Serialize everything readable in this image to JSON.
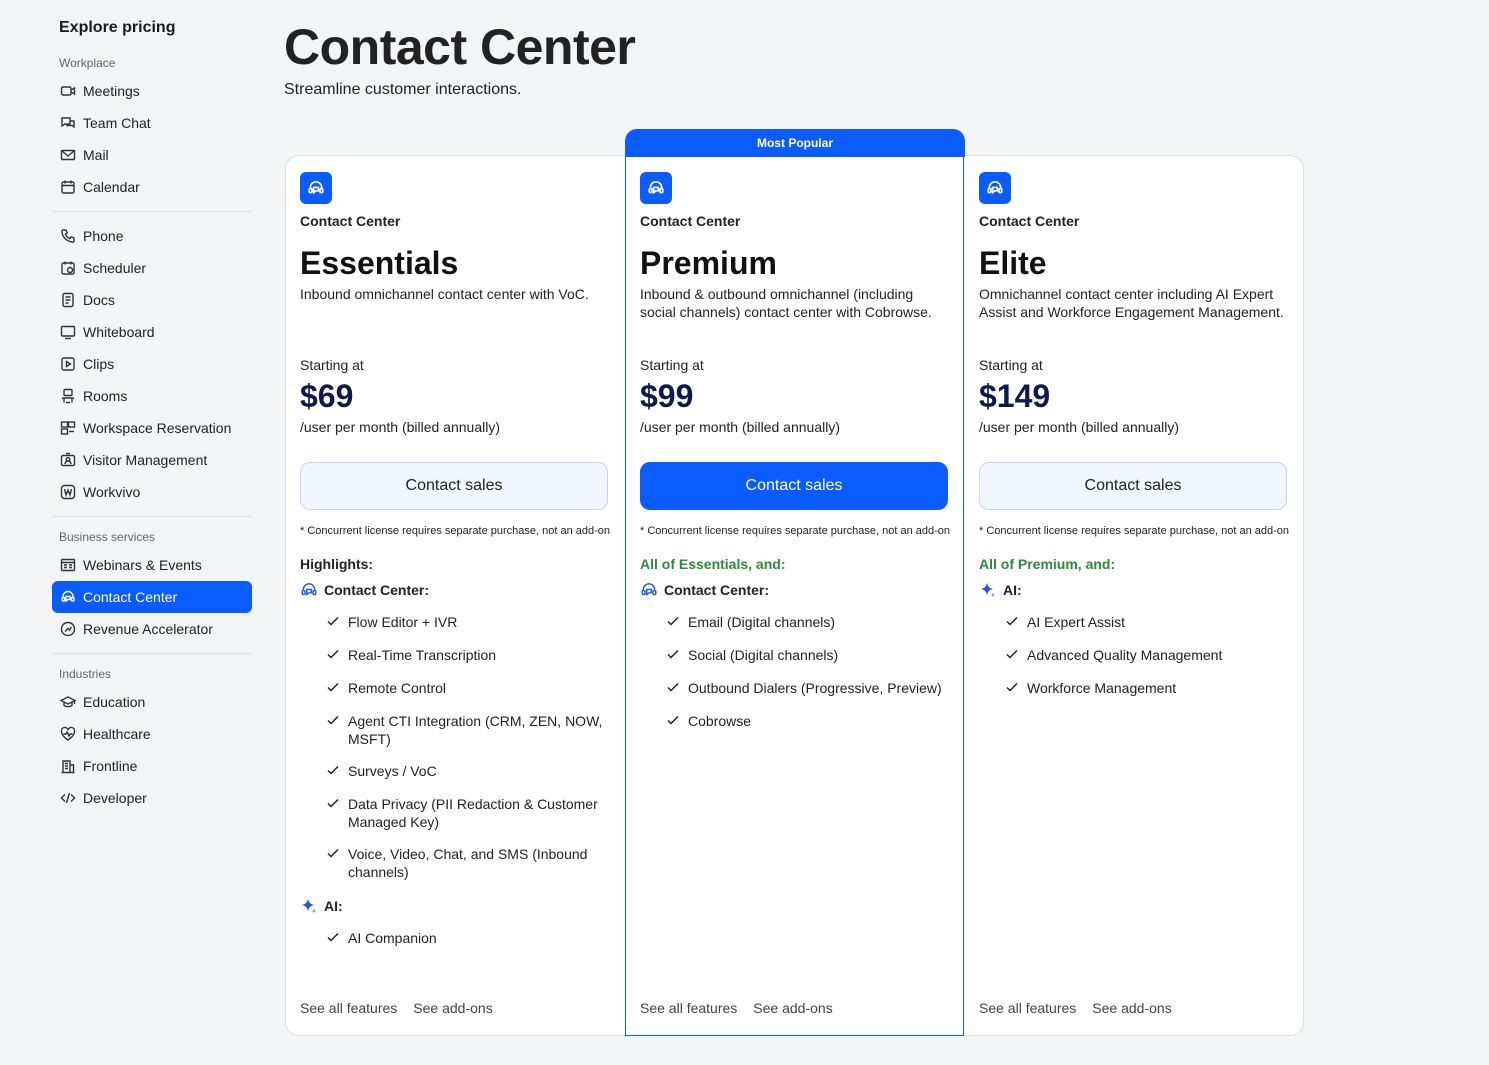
{
  "sidebar": {
    "title": "Explore pricing",
    "sections": {
      "workplace": "Workplace",
      "business": "Business services",
      "industries": "Industries"
    },
    "workplace_items": [
      {
        "label": "Meetings",
        "icon": "video-icon"
      },
      {
        "label": "Team Chat",
        "icon": "chat-icon"
      },
      {
        "label": "Mail",
        "icon": "mail-icon"
      },
      {
        "label": "Calendar",
        "icon": "calendar-icon"
      }
    ],
    "more_items": [
      {
        "label": "Phone",
        "icon": "phone-icon"
      },
      {
        "label": "Scheduler",
        "icon": "scheduler-icon"
      },
      {
        "label": "Docs",
        "icon": "docs-icon"
      },
      {
        "label": "Whiteboard",
        "icon": "whiteboard-icon"
      },
      {
        "label": "Clips",
        "icon": "clips-icon"
      },
      {
        "label": "Rooms",
        "icon": "rooms-icon"
      },
      {
        "label": "Workspace Reservation",
        "icon": "workspace-icon"
      },
      {
        "label": "Visitor Management",
        "icon": "visitor-icon"
      },
      {
        "label": "Workvivo",
        "icon": "workvivo-icon"
      }
    ],
    "business_items": [
      {
        "label": "Webinars & Events",
        "icon": "webinar-icon"
      },
      {
        "label": "Contact Center",
        "icon": "contact-center-icon",
        "active": true
      },
      {
        "label": "Revenue Accelerator",
        "icon": "revenue-icon"
      }
    ],
    "industry_items": [
      {
        "label": "Education",
        "icon": "education-icon"
      },
      {
        "label": "Healthcare",
        "icon": "healthcare-icon"
      },
      {
        "label": "Frontline",
        "icon": "frontline-icon"
      },
      {
        "label": "Developer",
        "icon": "code-icon"
      }
    ]
  },
  "header": {
    "title": "Contact Center",
    "subtitle": "Streamline customer interactions."
  },
  "popular_label": "Most Popular",
  "accent": "#0b5cff",
  "green": "#2b8a3e",
  "plans": [
    {
      "product": "Contact Center",
      "name": "Essentials",
      "desc": "Inbound omnichannel contact center with VoC.",
      "starting": "Starting at",
      "price": "$69",
      "per": "/user per month (billed annually)",
      "cta": "Contact sales",
      "note": "* Concurrent license requires separate purchase, not an add-on",
      "highlights_title": "Highlights:",
      "groups": [
        {
          "label": "Contact Center:",
          "icon": "contact-center-icon",
          "features": [
            "Flow Editor + IVR",
            "Real-Time Transcription",
            "Remote Control",
            "Agent CTI Integration (CRM, ZEN, NOW, MSFT)",
            "Surveys / VoC",
            "Data Privacy (PII Redaction & Customer Managed Key)",
            "Voice, Video, Chat, and SMS (Inbound channels)"
          ]
        },
        {
          "label": "AI:",
          "icon": "ai-sparkle-icon",
          "features": [
            "AI Companion"
          ]
        }
      ],
      "links": [
        "See all features",
        "See add-ons"
      ]
    },
    {
      "product": "Contact Center",
      "name": "Premium",
      "desc": "Inbound & outbound omnichannel (including social channels) contact center with Cobrowse.",
      "starting": "Starting at",
      "price": "$99",
      "per": "/user per month (billed annually)",
      "cta": "Contact sales",
      "note": "* Concurrent license requires separate purchase, not an add-on",
      "highlights_title": "All of Essentials, and:",
      "groups": [
        {
          "label": "Contact Center:",
          "icon": "contact-center-icon",
          "features": [
            "Email (Digital channels)",
            "Social (Digital channels)",
            "Outbound Dialers (Progressive, Preview)",
            "Cobrowse"
          ]
        }
      ],
      "links": [
        "See all features",
        "See add-ons"
      ]
    },
    {
      "product": "Contact Center",
      "name": "Elite",
      "desc": "Omnichannel contact center including AI Expert Assist and Workforce Engagement Management.",
      "starting": "Starting at",
      "price": "$149",
      "per": "/user per month (billed annually)",
      "cta": "Contact sales",
      "note": "* Concurrent license requires separate purchase, not an add-on",
      "highlights_title": "All of Premium, and:",
      "groups": [
        {
          "label": "AI:",
          "icon": "ai-sparkle-icon",
          "features": [
            "AI Expert Assist",
            "Advanced Quality Management",
            "Workforce Management"
          ]
        }
      ],
      "links": [
        "See all features",
        "See add-ons"
      ]
    }
  ]
}
